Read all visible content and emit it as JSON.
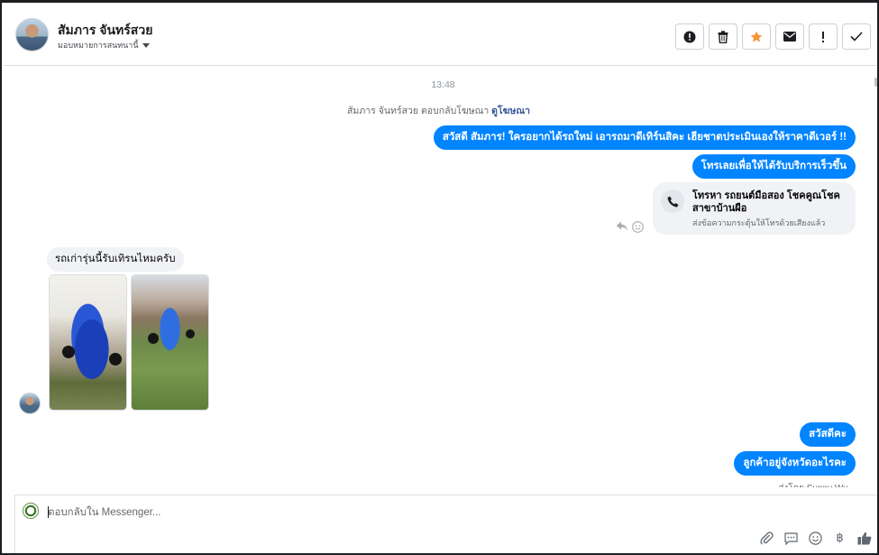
{
  "header": {
    "contact_name": "สัมภาร จันทร์สวย",
    "assign_label": "มอบหมายการสนทนานี้",
    "tools": [
      {
        "name": "mark-spam-button",
        "icon": "alert-circle-icon",
        "glyph": "!"
      },
      {
        "name": "delete-button",
        "icon": "trash-icon",
        "glyph": "🗑"
      },
      {
        "name": "star-button",
        "icon": "star-icon",
        "glyph": "★"
      },
      {
        "name": "mark-unread-button",
        "icon": "envelope-icon",
        "glyph": "✉"
      },
      {
        "name": "follow-up-button",
        "icon": "exclamation-icon",
        "glyph": "!"
      },
      {
        "name": "mark-done-button",
        "icon": "check-icon",
        "glyph": "✓"
      }
    ],
    "star_color": "#f7923a"
  },
  "thread": {
    "timestamp": "13:48",
    "replied_text": "สัมภาร จันทร์สวย ตอบกลับโฆษณา",
    "replied_link": "ดูโฆษณา",
    "outgoing_1": "สวัสดี สัมภาร! ใครอยากได้รถใหม่ เอารถมาดีเทิร์นสิคะ เฮียชาตประเมินเองให้ราคาดีเวอร์ !!",
    "outgoing_2": "โทรเลยเพื่อให้ได้รับบริการเร็วขึ้น",
    "call_card": {
      "title": "โทรหา รถยนต์มือสอง โชคคูณโชค สาขาบ้านผือ",
      "subtitle": "ส่งข้อความกระตุ้นให้โทรด้วยเสียงแล้ว"
    },
    "incoming_1": "รถเก่ารุ่นนี้รับเทิรนไหมครับ",
    "outgoing_3": "สวัสดีคะ",
    "outgoing_4": "ลูกค้าอยู่จังหวัดอะไรคะ",
    "partial_text": "ส่งโดย Sunny Wu..."
  },
  "composer": {
    "placeholder": "ตอบกลับใน Messenger...",
    "actions": [
      {
        "name": "attach-icon",
        "glyph": "📎"
      },
      {
        "name": "saved-reply-icon",
        "glyph": "💬"
      },
      {
        "name": "emoji-icon",
        "glyph": "☺"
      },
      {
        "name": "payment-icon",
        "glyph": "฿"
      },
      {
        "name": "like-icon",
        "glyph": "👍"
      }
    ]
  },
  "colors": {
    "accent": "#0084ff",
    "incoming_bubble": "#f0f2f5"
  }
}
